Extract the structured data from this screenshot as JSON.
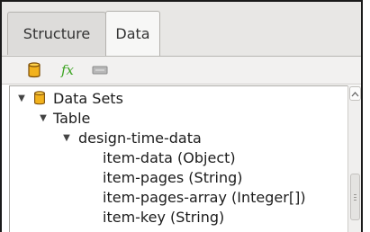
{
  "tabs": [
    "Structure",
    "Data"
  ],
  "active_tab": "Data",
  "toolbar": {
    "icons": [
      "database-icon",
      "function-fx-icon",
      "parameter-icon"
    ],
    "fx_text": "fx"
  },
  "tree": [
    {
      "label": "Data Sets",
      "icon": "database-icon",
      "expanded": true
    },
    {
      "label": "Table",
      "expanded": true
    },
    {
      "label": "design-time-data",
      "expanded": true
    },
    {
      "label": "item-data (Object)"
    },
    {
      "label": "item-pages (String)"
    },
    {
      "label": "item-pages-array (Integer[])"
    },
    {
      "label": "item-key (String)"
    }
  ],
  "colors": {
    "accent": "#f2b21d",
    "fx": "#3aa31f",
    "selected_tab": "#f7f7f6"
  }
}
